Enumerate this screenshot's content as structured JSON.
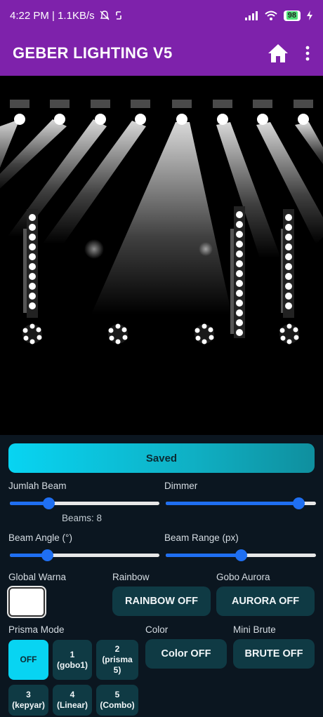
{
  "status_bar": {
    "time_speed": "4:22 PM | 1.1KB/s",
    "battery": "98"
  },
  "app_bar": {
    "title": "GEBER LIGHTING V5"
  },
  "controls": {
    "saved_label": "Saved",
    "jumlah_beam_label": "Jumlah Beam",
    "jumlah_beam_value": 0.24,
    "beams_count_text": "Beams: 8",
    "dimmer_label": "Dimmer",
    "dimmer_value": 0.92,
    "beam_angle_label": "Beam Angle (°)",
    "beam_angle_value": 0.23,
    "beam_range_label": "Beam Range (px)",
    "beam_range_value": 0.5,
    "global_warna_label": "Global Warna",
    "global_warna_color": "#ffffff",
    "rainbow_label": "Rainbow",
    "rainbow_button": "RAINBOW OFF",
    "gobo_aurora_label": "Gobo Aurora",
    "aurora_button": "AURORA OFF",
    "prisma_mode_label": "Prisma Mode",
    "color_label": "Color",
    "color_button": "Color OFF",
    "mini_brute_label": "Mini Brute",
    "brute_button": "BRUTE OFF",
    "prisma_modes": [
      "OFF",
      "1\n(gobo1)",
      "2\n(prisma\n5)",
      "3\n(kepyar)",
      "4\n(Linear)",
      "5\n(Combo)"
    ]
  },
  "colors": {
    "app_bar": "#7e22ab",
    "accent": "#08d4f2",
    "slider": "#1f6ff2",
    "button": "#0f3a44"
  }
}
